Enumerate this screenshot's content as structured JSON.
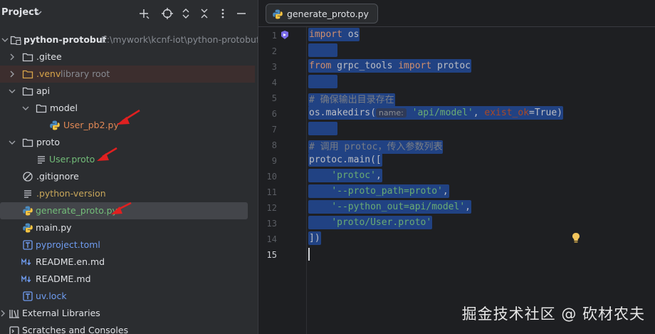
{
  "project_panel": {
    "title": "Project",
    "tree": [
      {
        "label": "python-protobuf",
        "hint": "E:\\mywork\\kcnf-iot\\python-protobuf"
      },
      {
        "label": ".gitee"
      },
      {
        "label": ".venv",
        "hint": "library root"
      },
      {
        "label": "api"
      },
      {
        "label": "model"
      },
      {
        "label": "User_pb2.py"
      },
      {
        "label": "proto"
      },
      {
        "label": "User.proto"
      },
      {
        "label": ".gitignore"
      },
      {
        "label": ".python-version"
      },
      {
        "label": "generate_proto.py"
      },
      {
        "label": "main.py"
      },
      {
        "label": "pyproject.toml"
      },
      {
        "label": "README.en.md"
      },
      {
        "label": "README.md"
      },
      {
        "label": "uv.lock"
      },
      {
        "label": "External Libraries"
      },
      {
        "label": "Scratches and Consoles"
      }
    ]
  },
  "editor": {
    "tab_label": "generate_proto.py",
    "line_numbers": [
      "1",
      "2",
      "3",
      "4",
      "5",
      "6",
      "7",
      "8",
      "9",
      "10",
      "11",
      "12",
      "13",
      "14",
      "15"
    ],
    "code": {
      "l1_kw": "import",
      "l1_rest": " os",
      "l3_kw1": "from",
      "l3_mid": " grpc_tools ",
      "l3_kw2": "import",
      "l3_rest": " protoc",
      "l5_comment": "# 确保输出目录存在",
      "l6_a": "os.makedirs(",
      "l6_hint": "name:",
      "l6_str": "'api/model'",
      "l6_comma": ", ",
      "l6_kwarg": "exist_ok",
      "l6_eq": "=True)",
      "l8_comment": "# 调用 protoc，传入参数列表",
      "l9": "protoc.main([",
      "l10": "'protoc'",
      "l11": "'--proto_path=proto'",
      "l12": "'--python_out=api/model'",
      "l13": "'proto/User.proto'",
      "l14": "])"
    }
  },
  "watermark": "掘金技术社区 @ 砍材农夫",
  "colors": {
    "selection": "#214283",
    "keyword": "#cf8e6d",
    "string": "#6aab73",
    "comment": "#7a7e85",
    "annotation_arrow": "#e02020"
  }
}
